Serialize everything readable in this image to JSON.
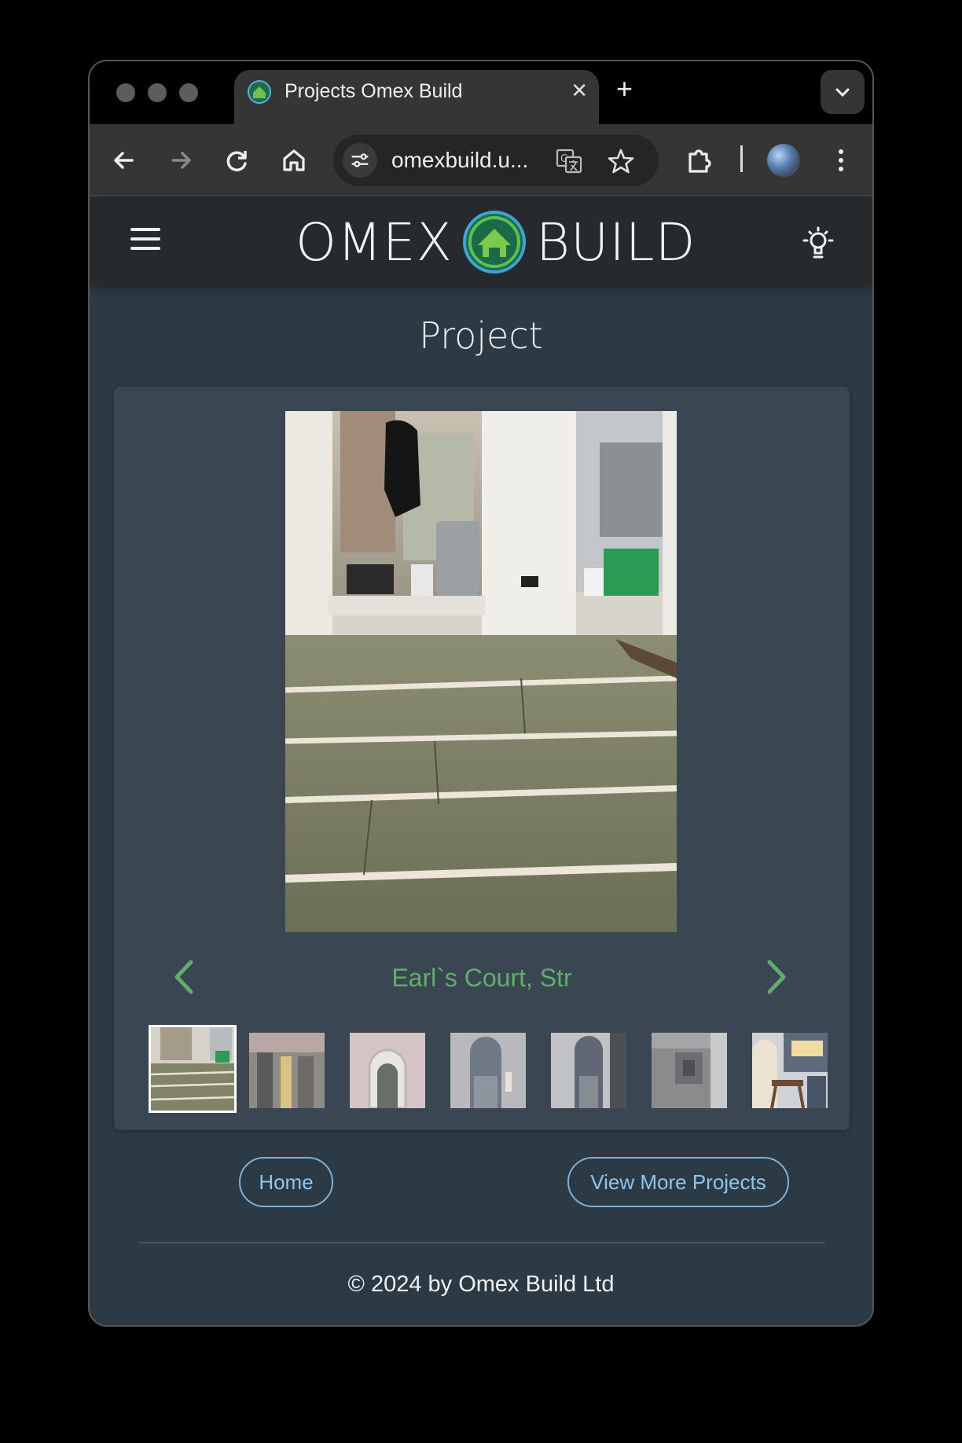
{
  "browser": {
    "tab_title": "Projects Omex Build",
    "url": "omexbuild.u..."
  },
  "site": {
    "logo_left": "OMEX",
    "logo_right": "BUILD",
    "page_title": "Project"
  },
  "project": {
    "caption": "Earl`s Court, Str",
    "thumbnail_count": 7,
    "active_thumbnail": 1
  },
  "actions": {
    "home_label": "Home",
    "more_label": "View More Projects"
  },
  "footer": {
    "copyright": "© 2024 by Omex Build Ltd"
  },
  "colors": {
    "accent_green": "#5fae6a",
    "link_blue": "#8ec5ea",
    "page_bg": "#2c3a45",
    "header_bg": "#262a2c"
  }
}
